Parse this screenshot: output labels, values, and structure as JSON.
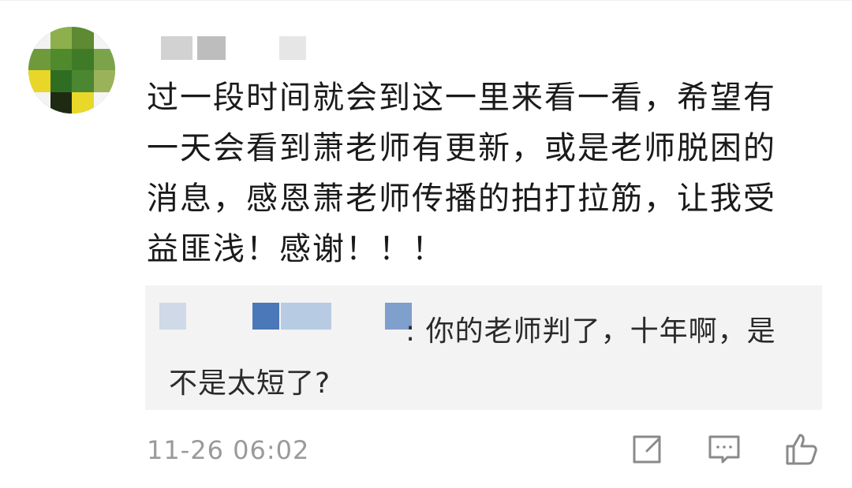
{
  "comment": {
    "lines": [
      "过一段时间就会到这一里来看一看，希望有",
      "一天会看到萧老师有更新，或是老师脱困的",
      "消息，感恩萧老师传播的拍打拉筋，让我受",
      "益匪浅！感谢！！！"
    ]
  },
  "reply": {
    "separator": ":",
    "text": "你的老师判了，十年啊，是不是太短了?"
  },
  "footer": {
    "timestamp": "11-26 06:02"
  },
  "icons": {
    "share": "share-icon",
    "comment": "comment-icon",
    "like": "like-icon"
  },
  "colors": {
    "reply_background": "#f3f3f3",
    "username_blur": "#5b7fb4",
    "timestamp": "#9a9a9a"
  }
}
